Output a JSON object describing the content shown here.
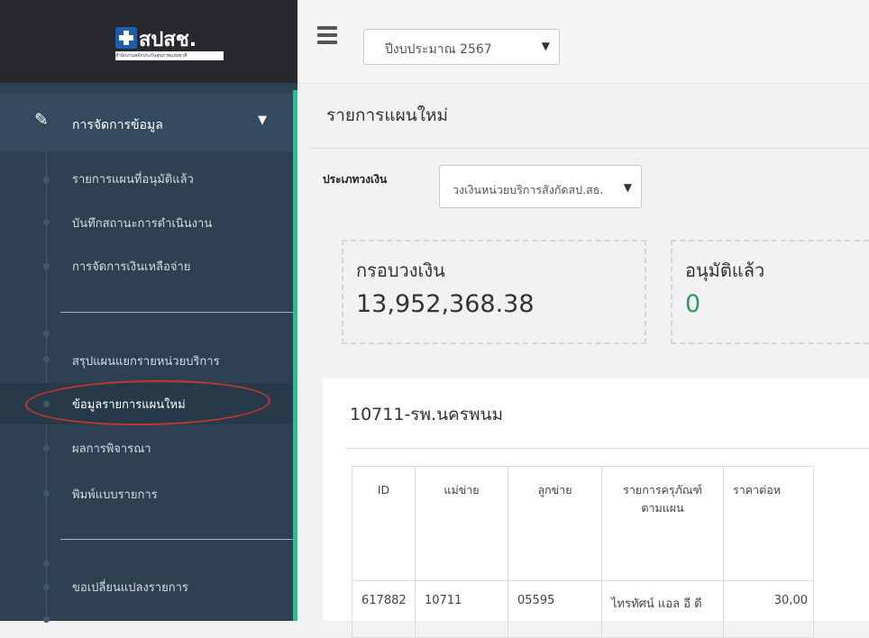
{
  "logo": {
    "text": "สปสช.",
    "subtext": "สำนักงานหลักประกันสุขภาพแห่งชาติ"
  },
  "sidebar": {
    "menu_head": {
      "icon": "edit-icon",
      "label": "การจัดการข้อมูล",
      "caret": "chevron-down-icon"
    },
    "items": [
      {
        "label": "รายการแผนที่อนุมัติแล้ว"
      },
      {
        "label": "บันทึกสถานะการดำเนินงาน"
      },
      {
        "label": "การจัดการเงินเหลือจ่าย"
      },
      {
        "label": "สรุปแผนแยกรายหน่วยบริการ"
      },
      {
        "label": "ข้อมูลรายการแผนใหม่",
        "active": true
      },
      {
        "label": "ผลการพิจารณา"
      },
      {
        "label": "พิมพ์แบบรายการ"
      },
      {
        "label": "ขอเปลี่ยนแปลงรายการ"
      }
    ]
  },
  "topbar": {
    "fiscal_year": "ปีงบประมาณ 2567"
  },
  "page": {
    "title": "รายการแผนใหม่"
  },
  "filter": {
    "label": "ประเภทวงเงิน",
    "value": "วงเงินหน่วยบริการสังกัดสป.สธ."
  },
  "cards": [
    {
      "label": "กรอบวงเงิน",
      "value": "13,952,368.38"
    },
    {
      "label": "อนุมัติแล้ว",
      "value": "0"
    }
  ],
  "panel": {
    "title": "10711-รพ.นครพนม",
    "columns": [
      "ID",
      "แม่ข่าย",
      "ลูกข่าย",
      "รายการครุภัณฑ์ ตามแผน",
      "ราคาต่อห"
    ],
    "rows": [
      [
        "617882",
        "10711",
        "05595",
        "ไทรทัศน์ แอล อี ดี",
        "30,00"
      ]
    ]
  },
  "colors": {
    "sidebar": "#2e4152",
    "accent": "#2bbf8f",
    "highlight": "#c0392b"
  }
}
